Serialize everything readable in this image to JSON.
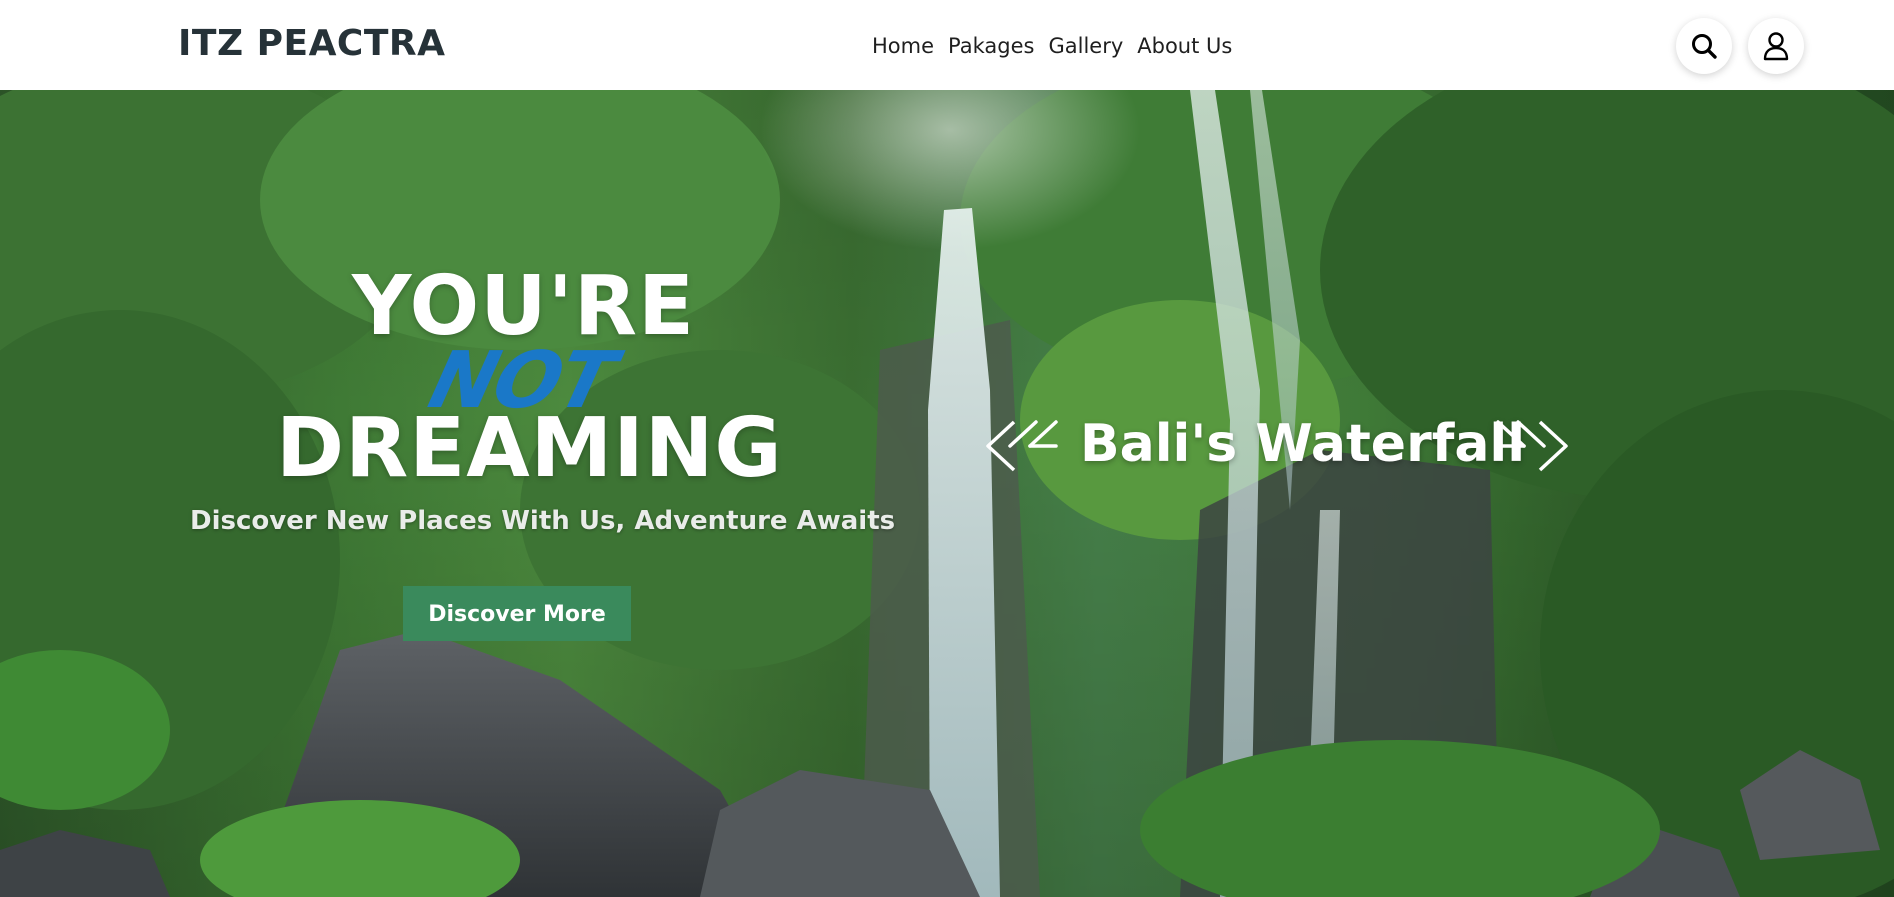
{
  "header": {
    "brand": "ITZ PEACTRA",
    "nav": [
      "Home",
      "Pakages",
      "Gallery",
      "About Us"
    ],
    "icons": [
      "search-icon",
      "user-icon"
    ]
  },
  "hero": {
    "headline_line1": "YOU'RE",
    "headline_line2": "NOT",
    "headline_line3": "DREAMING",
    "subtitle": "Discover New Places With Us, Adventure Awaits",
    "cta_label": "Discover More",
    "slide_title": "Bali's Waterfall",
    "colors": {
      "accent_blue": "#1a78c8",
      "cta_green": "#3a8a5c",
      "brand_text": "#263238"
    }
  }
}
